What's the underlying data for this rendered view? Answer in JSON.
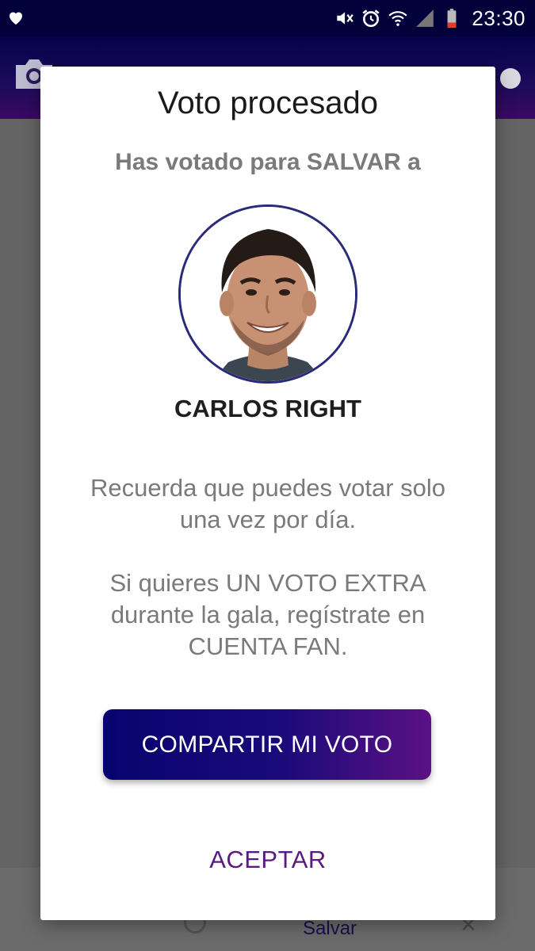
{
  "status_bar": {
    "time": "23:30",
    "icons": [
      "heart-icon",
      "mute-icon",
      "alarm-icon",
      "wifi-icon",
      "signal-icon",
      "battery-icon"
    ]
  },
  "background": {
    "bottom_nav_active_label": "Salvar"
  },
  "dialog": {
    "title": "Voto procesado",
    "subtitle": "Has votado para SALVAR a",
    "candidate_name": "CARLOS RIGHT",
    "note_1": "Recuerda que puedes votar solo una vez por día.",
    "note_2": "Si quieres UN VOTO EXTRA durante la gala, regístrate en CUENTA FAN.",
    "share_button": "COMPARTIR MI VOTO",
    "accept_button": "ACEPTAR"
  },
  "colors": {
    "status_bar": "#03013a",
    "accent_gradient_start": "#07046e",
    "accent_gradient_end": "#5b1183",
    "accept_text": "#5a1a80",
    "overlay": "#646464"
  }
}
